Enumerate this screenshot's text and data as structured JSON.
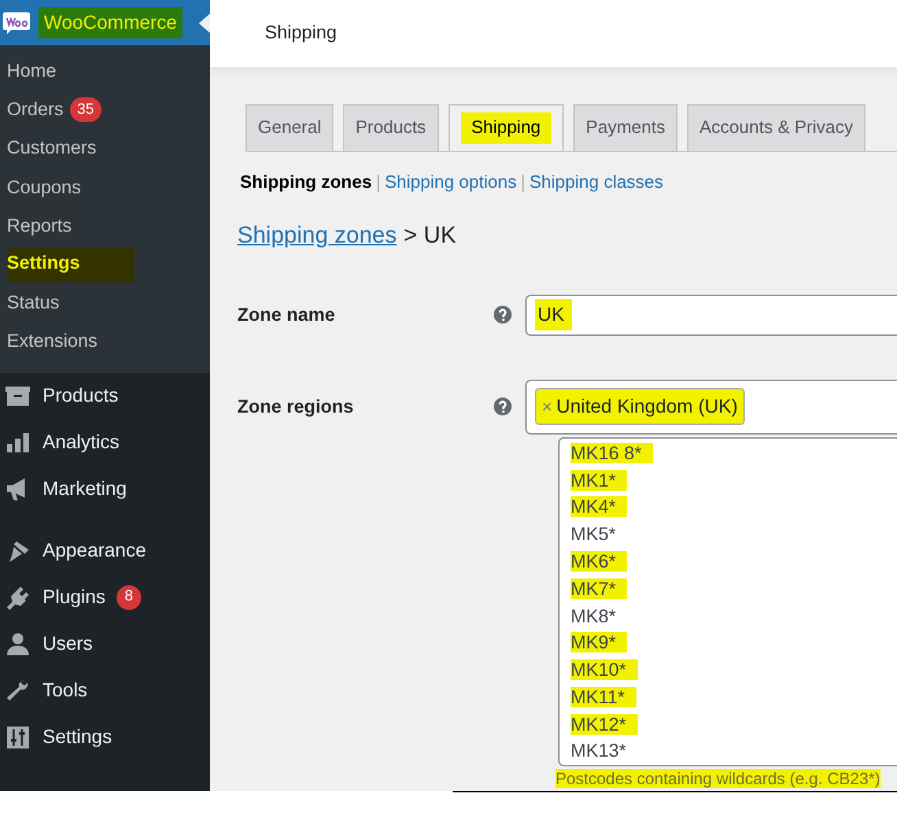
{
  "sidebar": {
    "header": {
      "label": "WooCommerce",
      "highlighted": true
    },
    "submenu": [
      {
        "label": "Home",
        "selected": false,
        "highlighted": false
      },
      {
        "label": "Orders",
        "badge": "35",
        "selected": false,
        "highlighted": false
      },
      {
        "label": "Customers",
        "selected": false,
        "highlighted": false
      },
      {
        "label": "Coupons",
        "selected": false,
        "highlighted": false
      },
      {
        "label": "Reports",
        "selected": false,
        "highlighted": false
      },
      {
        "label": "Settings",
        "selected": true,
        "highlighted": true
      },
      {
        "label": "Status",
        "selected": false,
        "highlighted": false
      },
      {
        "label": "Extensions",
        "selected": false,
        "highlighted": false
      }
    ],
    "menu": [
      {
        "label": "Products"
      },
      {
        "label": "Analytics"
      },
      {
        "label": "Marketing"
      },
      {
        "label": "Appearance"
      },
      {
        "label": "Plugins",
        "badge": "8"
      },
      {
        "label": "Users"
      },
      {
        "label": "Tools"
      },
      {
        "label": "Settings"
      }
    ]
  },
  "top_bar": {
    "title": "Shipping"
  },
  "tabs": [
    {
      "label": "General",
      "selected": false,
      "highlighted": false
    },
    {
      "label": "Products",
      "selected": false,
      "highlighted": false
    },
    {
      "label": "Shipping",
      "selected": true,
      "highlighted": true
    },
    {
      "label": "Payments",
      "selected": false,
      "highlighted": false
    },
    {
      "label": "Accounts & Privacy",
      "selected": false,
      "highlighted": false
    }
  ],
  "subnav": [
    {
      "label": "Shipping zones",
      "selected": true
    },
    {
      "divider": "|",
      "label": "Shipping options",
      "selected": false
    },
    {
      "divider": "|",
      "label": "Shipping classes",
      "selected": false
    }
  ],
  "breadcrumb": {
    "link": "Shipping zones",
    "current": "> UK"
  },
  "form": {
    "zone_name": {
      "label": "Zone name",
      "value": "UK",
      "highlighted": true
    },
    "zone_regions": {
      "label": "Zone regions",
      "tags": [
        {
          "remove": "×",
          "label": "United Kingdom (UK)",
          "highlighted": true
        }
      ]
    },
    "postcodes": {
      "lines": [
        {
          "text": "MK16 8*",
          "highlighted": true
        },
        {
          "text": "MK1*",
          "highlighted": true
        },
        {
          "text": "MK4*",
          "highlighted": true
        },
        {
          "text": "MK5*",
          "highlighted": false
        },
        {
          "text": "MK6*",
          "highlighted": true
        },
        {
          "text": "MK7*",
          "highlighted": true
        },
        {
          "text": "MK8*",
          "highlighted": false
        },
        {
          "text": "MK9*",
          "highlighted": true
        },
        {
          "text": "MK10*",
          "highlighted": true
        },
        {
          "text": "MK11*",
          "highlighted": true
        },
        {
          "text": "MK12*",
          "highlighted": true
        },
        {
          "text": "MK13*",
          "highlighted": false
        }
      ],
      "description": {
        "text": "Postcodes containing wildcards (e.g. CB23*)",
        "highlighted": true
      }
    }
  }
}
